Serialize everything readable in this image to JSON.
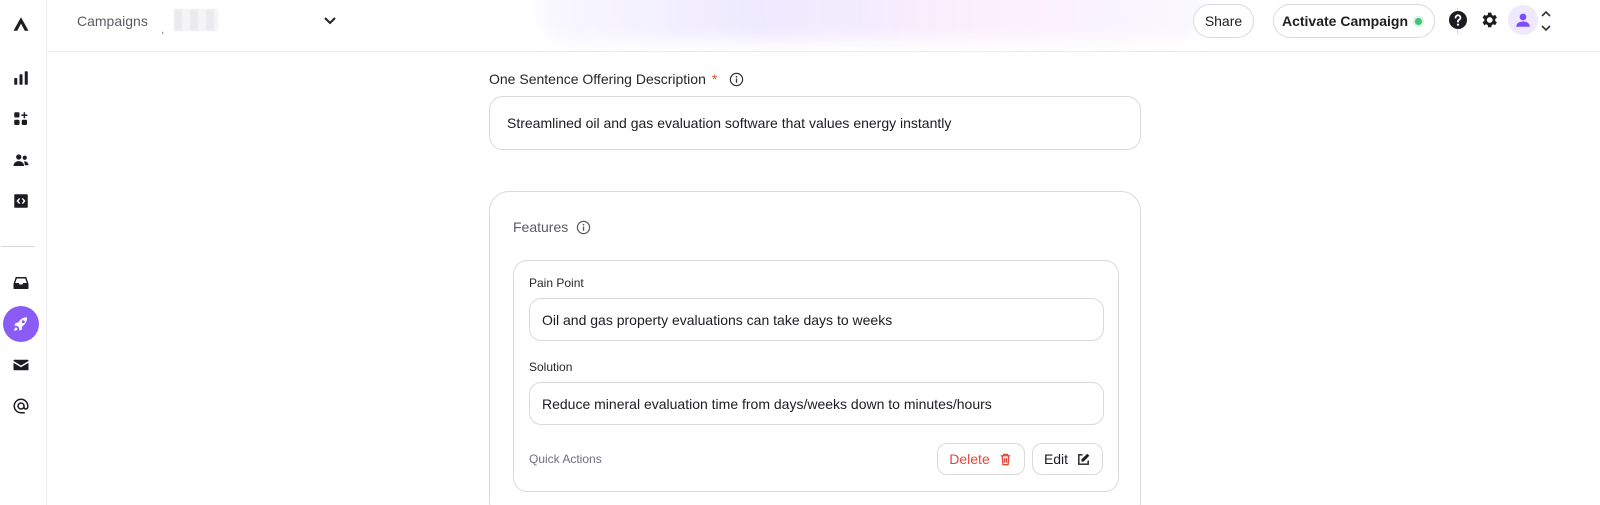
{
  "breadcrumb": {
    "root": "Campaigns",
    "separator": ","
  },
  "header": {
    "share_label": "Share",
    "activate_label": "Activate Campaign",
    "status_color": "#41c277"
  },
  "sidebar": {
    "items": [
      {
        "name": "logo",
        "icon": "logo-icon"
      },
      {
        "name": "analytics",
        "icon": "bar-chart-icon"
      },
      {
        "name": "apps",
        "icon": "widgets-add-icon"
      },
      {
        "name": "contacts",
        "icon": "people-icon"
      },
      {
        "name": "code",
        "icon": "code-icon"
      },
      {
        "name": "inbox",
        "icon": "inbox-icon"
      },
      {
        "name": "campaigns",
        "icon": "rocket-icon",
        "active": true
      },
      {
        "name": "mail",
        "icon": "mail-icon"
      },
      {
        "name": "mentions",
        "icon": "at-icon"
      }
    ],
    "accent": "#8a5cf5"
  },
  "form": {
    "description_label": "One Sentence Offering Description",
    "required_mark": "*",
    "description_value": "Streamlined oil and gas evaluation software that values energy instantly",
    "features_title": "Features",
    "feature": {
      "pain_label": "Pain Point",
      "pain_value": "Oil and gas property evaluations can take days to weeks",
      "solution_label": "Solution",
      "solution_value": "Reduce mineral evaluation time from days/weeks down to minutes/hours",
      "quick_actions_label": "Quick Actions",
      "delete_label": "Delete",
      "edit_label": "Edit"
    }
  }
}
